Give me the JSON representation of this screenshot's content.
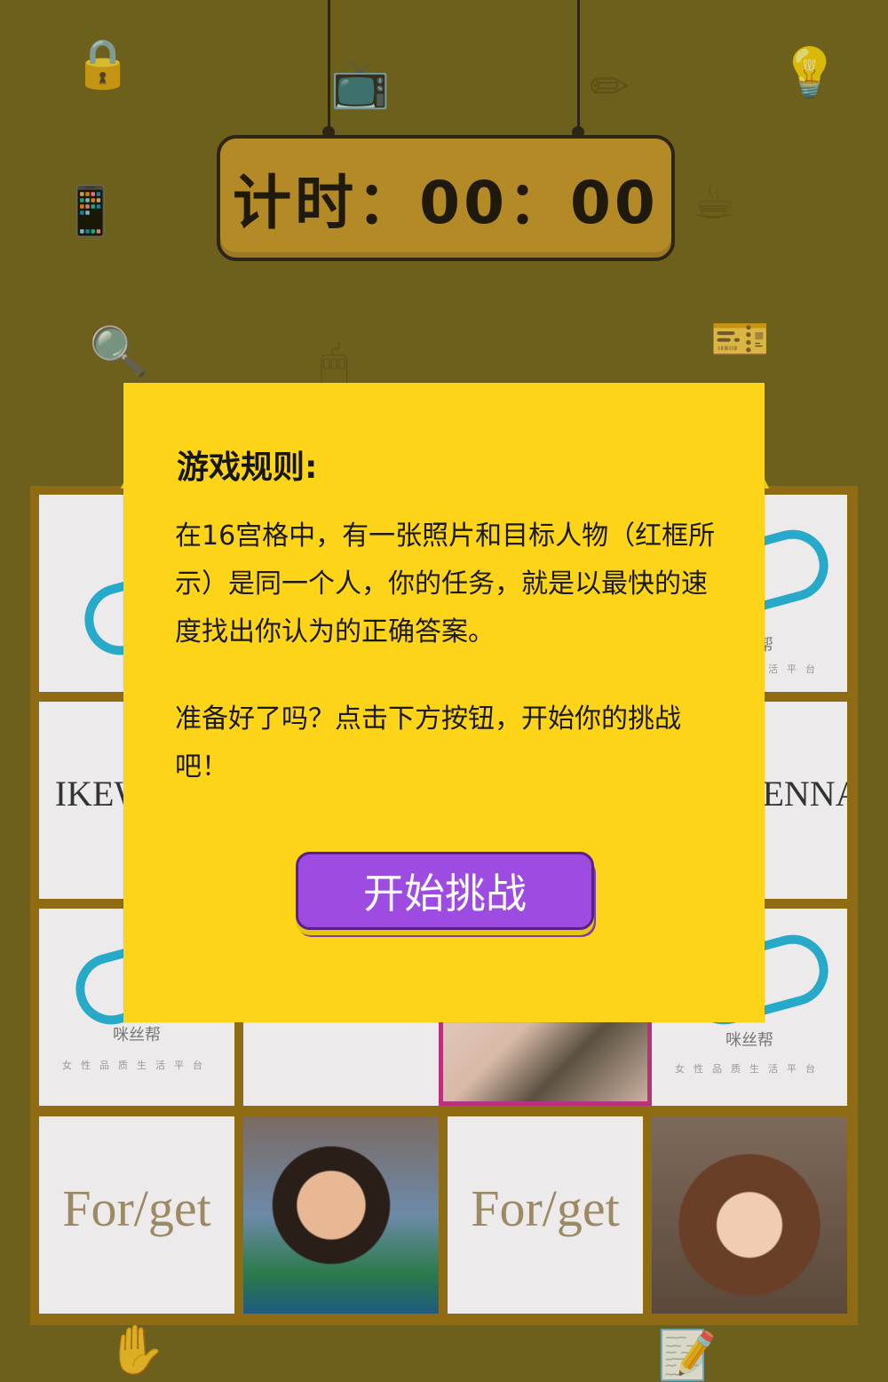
{
  "timer": {
    "label": "计时：00：00"
  },
  "rules": {
    "title": "游戏规则:",
    "paragraph1": "在16宫格中，有一张照片和目标人物（红框所示）是同一个人，你的任务，就是以最快的速度找出你认为的正确答案。",
    "paragraph2": "准备好了吗？点击下方按钮，开始你的挑战吧！",
    "start_button": "开始挑战"
  },
  "tiles": {
    "brand_mixi": "咪丝帮",
    "brand_mixi_sub": "女性品质生活平台",
    "brand_ikew": "IKEW",
    "brand_enna": "ENNA",
    "brand_forget": "For/get"
  },
  "colors": {
    "background": "#6d5f1c",
    "card": "#fdd417",
    "button": "#9d4be0",
    "highlight": "#b7327a"
  }
}
